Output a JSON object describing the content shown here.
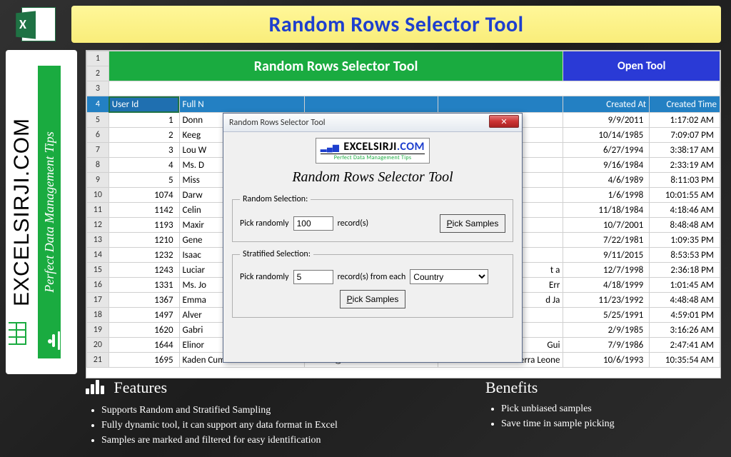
{
  "banner": {
    "title": "Random Rows Selector Tool"
  },
  "sidebar": {
    "brand": "EXCELSIRJI.COM",
    "tagline": "Perfect Data Management Tips"
  },
  "sheet": {
    "green_title": "Random Rows Selector Tool",
    "open_tool": "Open Tool",
    "row_nums": [
      "1",
      "2",
      "3",
      "4",
      "5",
      "6",
      "7",
      "8",
      "9",
      "10",
      "11",
      "12",
      "13",
      "14",
      "15",
      "16",
      "17",
      "18",
      "19",
      "20",
      "21"
    ],
    "headers": {
      "user_id": "User Id",
      "full_name": "Full N",
      "created_at": "Created At",
      "created_time": "Created Time"
    },
    "rows": [
      {
        "id": "1",
        "name": "Donn",
        "email": "",
        "country": "",
        "date": "9/9/2011",
        "time": "1:17:02 AM"
      },
      {
        "id": "2",
        "name": "Keeg",
        "email": "",
        "country": "",
        "date": "10/14/1985",
        "time": "7:09:07 PM"
      },
      {
        "id": "3",
        "name": "Lou W",
        "email": "",
        "country": "",
        "date": "6/27/1994",
        "time": "3:38:17 AM"
      },
      {
        "id": "4",
        "name": "Ms. D",
        "email": "",
        "country": "",
        "date": "9/16/1984",
        "time": "2:33:19 AM"
      },
      {
        "id": "5",
        "name": "Miss",
        "email": "",
        "country": "",
        "date": "4/6/1989",
        "time": "8:11:03 PM"
      },
      {
        "id": "1074",
        "name": "Darw",
        "email": "",
        "country": "",
        "date": "1/6/1998",
        "time": "10:01:55 AM"
      },
      {
        "id": "1142",
        "name": "Celin",
        "email": "",
        "country": "",
        "date": "11/18/1984",
        "time": "4:18:46 AM"
      },
      {
        "id": "1193",
        "name": "Maxir",
        "email": "",
        "country": "",
        "date": "10/7/2001",
        "time": "8:48:48 AM"
      },
      {
        "id": "1210",
        "name": "Gene",
        "email": "",
        "country": "",
        "date": "7/22/1981",
        "time": "1:09:35 PM"
      },
      {
        "id": "1232",
        "name": "Isaac",
        "email": "",
        "country": "",
        "date": "9/11/2015",
        "time": "8:53:53 PM"
      },
      {
        "id": "1243",
        "name": "Luciar",
        "email": "",
        "country": "t a",
        "date": "12/7/1998",
        "time": "2:36:18 PM"
      },
      {
        "id": "1331",
        "name": "Ms. Jo",
        "email": "",
        "country": "Err",
        "date": "4/18/1999",
        "time": "1:01:45 AM"
      },
      {
        "id": "1367",
        "name": "Emma",
        "email": "",
        "country": "d Ja",
        "date": "11/23/1992",
        "time": "4:48:48 AM"
      },
      {
        "id": "1497",
        "name": "Alver",
        "email": "",
        "country": "",
        "date": "5/25/1991",
        "time": "4:59:01 PM"
      },
      {
        "id": "1620",
        "name": "Gabri",
        "email": "",
        "country": "",
        "date": "2/9/1985",
        "time": "3:16:26 AM"
      },
      {
        "id": "1644",
        "name": "Elinor",
        "email": "",
        "country": "Gui",
        "date": "7/9/1986",
        "time": "2:47:41 AM"
      },
      {
        "id": "1695",
        "name": "Kaden Cummerata",
        "email": "Carson@eusebio.cor",
        "country": "318 Sierra Leone",
        "date": "10/6/1993",
        "time": "10:35:54 AM"
      }
    ]
  },
  "dialog": {
    "title": "Random Rows Selector Tool",
    "brand": "EXCELSIRJI",
    "brand_suffix": ".COM",
    "brand_tag": "Perfect Data Management Tips",
    "subtitle": "Random Rows Selector Tool",
    "random_section": {
      "legend": "Random Selection:",
      "prefix": "Pick randomly",
      "value": "100",
      "suffix": "record(s)",
      "button": "Pick Samples"
    },
    "stratified_section": {
      "legend": "Stratified Selection:",
      "prefix": "Pick randomly",
      "value": "5",
      "mid": "record(s) from each",
      "dropdown": "Country",
      "button": "Pick Samples"
    }
  },
  "features": {
    "title": "Features",
    "items": [
      "Supports Random and Stratified Sampling",
      "Fully dynamic tool, it can support any data format in Excel",
      "Samples are marked and filtered for easy identification"
    ]
  },
  "benefits": {
    "title": "Benefits",
    "items": [
      "Pick unbiased samples",
      "Save time in sample picking"
    ]
  }
}
